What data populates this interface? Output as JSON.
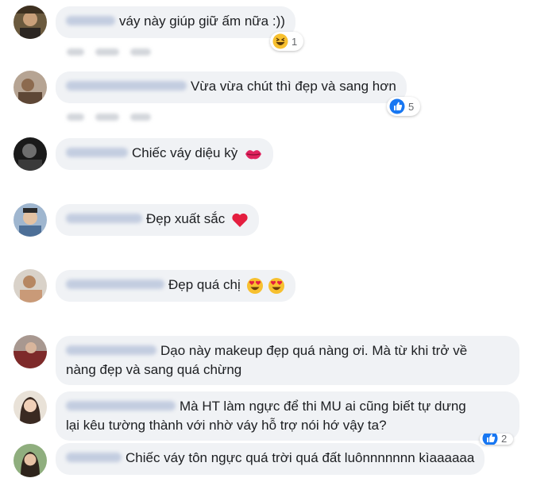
{
  "comments": [
    {
      "text": "váy này giúp giữ ấm nữa :))",
      "reaction": {
        "type": "haha",
        "count": "1"
      }
    },
    {
      "text": "Vừa vừa chút thì đẹp và sang hơn",
      "reaction": {
        "type": "like",
        "count": "5"
      }
    },
    {
      "text": "Chiếc váy diệu kỳ"
    },
    {
      "text": "Đẹp xuất sắc"
    },
    {
      "text": "Đẹp quá chị"
    },
    {
      "text_line1": "Dạo này makeup đẹp quá nàng ơi. Mà từ khi trở về",
      "text_line2": "nàng đẹp và sang quá chừng"
    },
    {
      "text_line1": "Mà HT làm ngực để thi MU ai cũng biết tự dưng",
      "text_line2": "lại kêu tường thành với nhờ váy hỗ trợ nói hớ vậy ta?",
      "reaction": {
        "type": "like",
        "count": "2"
      }
    },
    {
      "text": "Chiếc váy tôn ngực quá trời quá đất luônnnnnnn kìaaaaaa"
    }
  ],
  "colors": {
    "bubble": "#f0f2f5",
    "like_blue": "#1877f2",
    "heart_red": "#e41e3f",
    "emoji_yellow": "#f7c02f"
  }
}
